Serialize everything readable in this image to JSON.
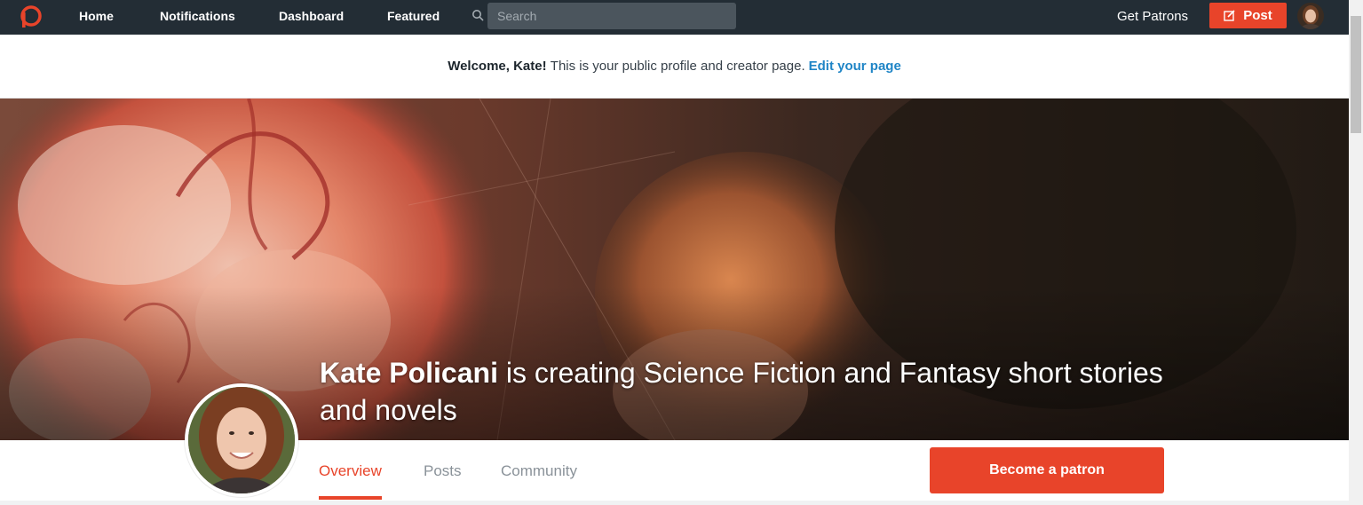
{
  "nav": {
    "links": [
      "Home",
      "Notifications",
      "Dashboard",
      "Featured"
    ],
    "search_placeholder": "Search",
    "search_value": "",
    "get_patrons": "Get Patrons",
    "post_label": "Post"
  },
  "welcome": {
    "greeting": "Welcome, Kate!",
    "message": "This is your public profile and creator page.",
    "edit_link": "Edit your page"
  },
  "cover": {
    "creator_name": "Kate Policani",
    "tagline": "is creating Science Fiction and Fantasy short stories and novels"
  },
  "tabs": {
    "overview": "Overview",
    "posts": "Posts",
    "community": "Community",
    "active": "Overview"
  },
  "become_patron": "Become a patron",
  "icons": {
    "logo": "patreon-logo-icon",
    "search": "search-icon",
    "post": "edit-icon",
    "avatar": "user-avatar"
  },
  "colors": {
    "brand": "#e8442a",
    "topbar": "#232d35",
    "link": "#1f85c6"
  }
}
